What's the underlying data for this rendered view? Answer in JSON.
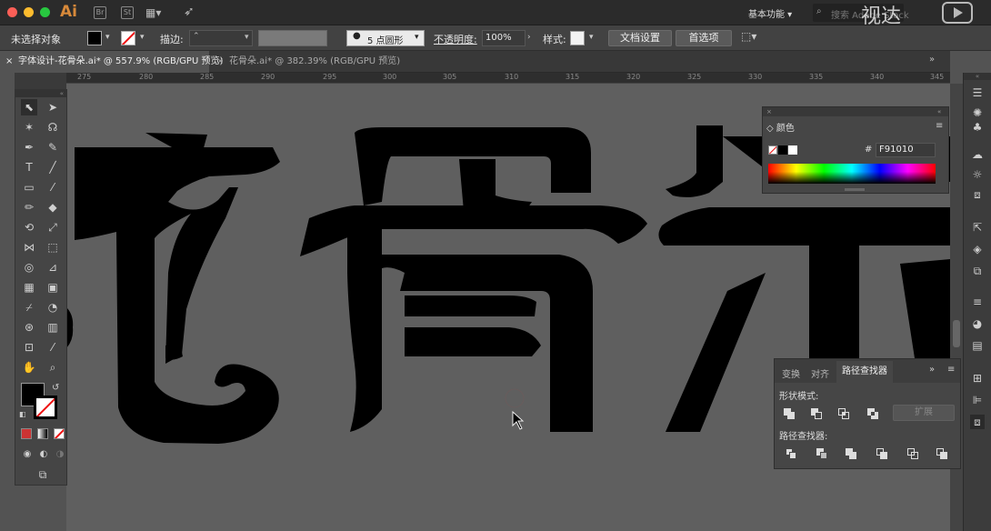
{
  "app": {
    "logo": "Ai",
    "workspace": "基本功能",
    "search_placeholder": "搜索 Adobe Stock",
    "watermark": "视达"
  },
  "control": {
    "selection": "未选择对象",
    "stroke_label": "描边:",
    "brush": "5 点圆形",
    "opacity_label": "不透明度:",
    "opacity_value": "100%",
    "style_label": "样式:",
    "doc_setup": "文档设置",
    "preferences": "首选项"
  },
  "tabs": [
    {
      "label": "字体设计-花骨朵.ai* @ 557.9% (RGB/GPU 预览)"
    },
    {
      "label": "花骨朵.ai* @ 382.39% (RGB/GPU 预览)"
    }
  ],
  "ruler_ticks": [
    "275",
    "280",
    "285",
    "290",
    "295",
    "300",
    "305",
    "310",
    "315",
    "320",
    "325",
    "330",
    "335",
    "340",
    "345"
  ],
  "color_panel": {
    "title": "颜色",
    "hash": "#",
    "hex": "F91010"
  },
  "pathfinder": {
    "tabs": [
      "变换",
      "对齐",
      "路径查找器"
    ],
    "shape_modes": "形状模式:",
    "expand": "扩展",
    "pathfinders": "路径查找器:"
  },
  "colors": {
    "fill": "#000000",
    "accent": "#F91010"
  }
}
